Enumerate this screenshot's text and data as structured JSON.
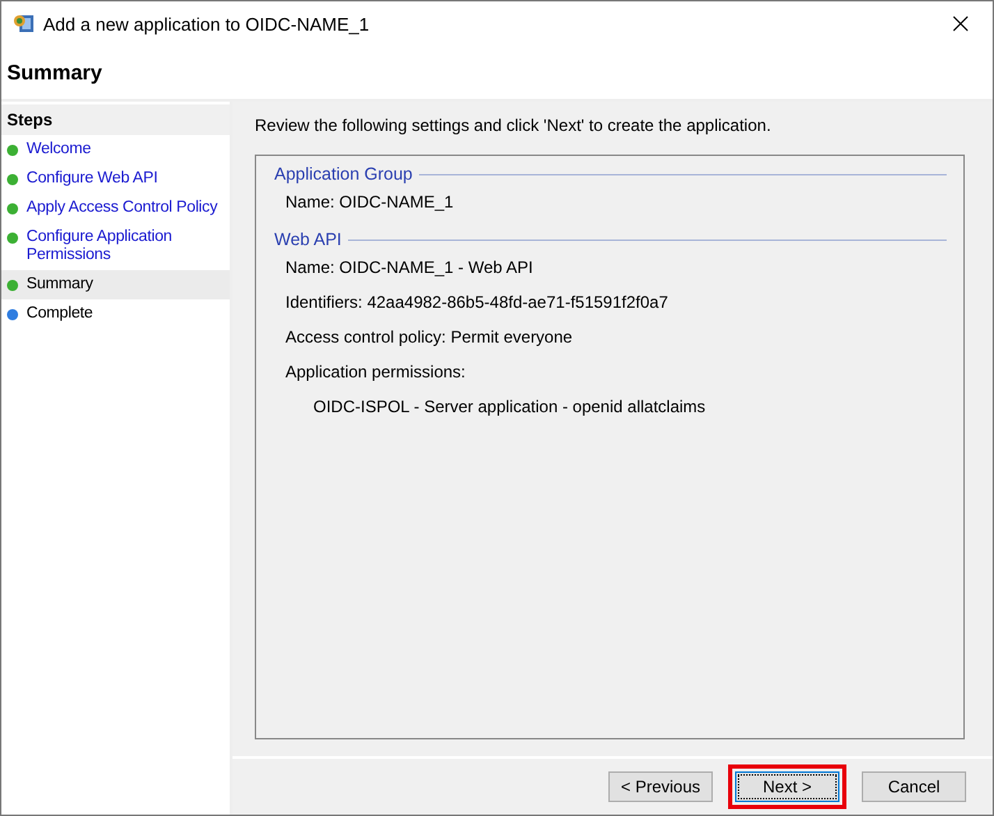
{
  "window": {
    "title": "Add a new application to OIDC-NAME_1"
  },
  "page_title": "Summary",
  "steps_title": "Steps",
  "steps": [
    {
      "label": "Welcome",
      "kind": "done",
      "selected": false
    },
    {
      "label": "Configure Web API",
      "kind": "done",
      "selected": false
    },
    {
      "label": "Apply Access Control Policy",
      "kind": "done",
      "selected": false
    },
    {
      "label": "Configure Application Permissions",
      "kind": "done",
      "selected": false
    },
    {
      "label": "Summary",
      "kind": "done",
      "selected": true
    },
    {
      "label": "Complete",
      "kind": "pending",
      "selected": false
    }
  ],
  "intro": "Review the following settings and click 'Next' to create the application.",
  "sections": [
    {
      "title": "Application Group",
      "lines": [
        {
          "text": "Name: OIDC-NAME_1",
          "indent": false
        }
      ]
    },
    {
      "title": "Web API",
      "lines": [
        {
          "text": "Name: OIDC-NAME_1 - Web API",
          "indent": false
        },
        {
          "text": "Identifiers: 42aa4982-86b5-48fd-ae71-f51591f2f0a7",
          "indent": false
        },
        {
          "text": "Access control policy: Permit everyone",
          "indent": false
        },
        {
          "text": "Application permissions:",
          "indent": false
        },
        {
          "text": "OIDC-ISPOL - Server application - openid allatclaims",
          "indent": true
        }
      ]
    }
  ],
  "buttons": [
    {
      "label": "< Previous",
      "focused": false,
      "highlighted": false
    },
    {
      "label": "Next >",
      "focused": true,
      "highlighted": true
    },
    {
      "label": "Cancel",
      "focused": false,
      "highlighted": false
    }
  ]
}
